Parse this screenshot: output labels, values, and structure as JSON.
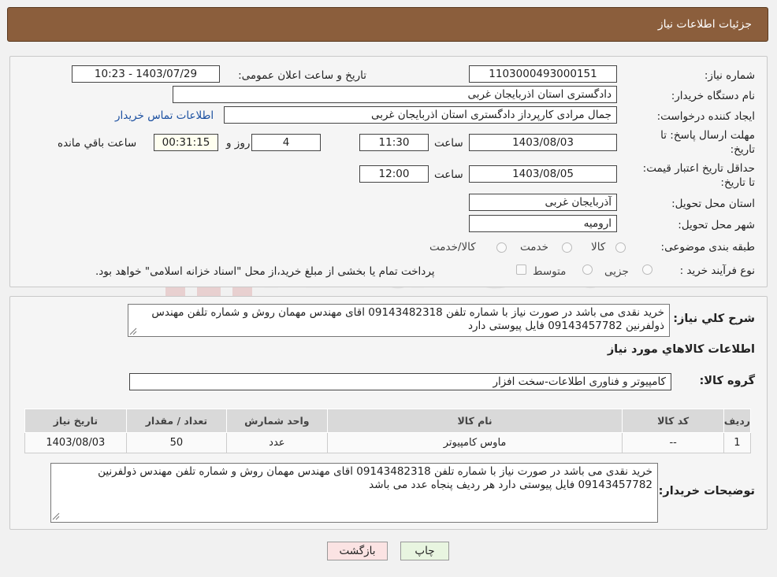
{
  "header": {
    "title": "جزئیات اطلاعات نیاز"
  },
  "form": {
    "need_number": {
      "label": "شماره نیاز:",
      "value": "1103000493000151"
    },
    "announce": {
      "label": "تاریخ و ساعت اعلان عمومی:",
      "value": "1403/07/29 - 10:23"
    },
    "buyer_org": {
      "label": "نام دستگاه خریدار:",
      "value": "دادگستری استان اذربایجان غربی"
    },
    "creator": {
      "label": "ایجاد کننده درخواست:",
      "value": "جمال مرادی کارپرداز دادگستری استان اذربایجان غربی",
      "link": "اطلاعات تماس خریدار"
    },
    "reply_deadline": {
      "label": "مهلت ارسال پاسخ: تا تاریخ:",
      "date": "1403/08/03",
      "time_label": "ساعت",
      "time": "11:30",
      "days": "4",
      "days_label": "روز و",
      "remaining": "00:31:15",
      "remaining_label": "ساعت باقي مانده"
    },
    "price_validity": {
      "label": "حداقل تاریخ اعتبار قیمت: تا تاریخ:",
      "date": "1403/08/05",
      "time_label": "ساعت",
      "time": "12:00"
    },
    "province": {
      "label": "استان محل تحویل:",
      "value": "آذربایجان غربی"
    },
    "city": {
      "label": "شهر محل تحویل:",
      "value": "ارومیه"
    },
    "category": {
      "label": "طبقه بندی موضوعی:",
      "options": [
        "کالا",
        "خدمت",
        "کالا/خدمت"
      ]
    },
    "purchase_type": {
      "label": "نوع فرآیند خرید :",
      "options": [
        "جزیی",
        "متوسط"
      ],
      "note": "پرداخت تمام یا بخشی از مبلغ خرید،از محل \"اسناد خزانه اسلامی\" خواهد بود."
    }
  },
  "watermark": {
    "text": "AriaTender.neT"
  },
  "description": {
    "label": "شرح کلي نياز:",
    "text": "خرید نقدی  می باشد در صورت نیاز با شماره تلفن 09143482318 اقای مهندس مهمان روش و شماره تلفن مهندس ذولفرنین 09143457782  فایل پیوستی دارد"
  },
  "goods_info": {
    "title": "اطلاعات کالاهاي مورد نياز"
  },
  "goods_group": {
    "label": "گروه کالا:",
    "value": "کامپیوتر و فناوری اطلاعات-سخت افزار"
  },
  "table": {
    "headers": [
      "ردیف",
      "کد کالا",
      "نام کالا",
      "واحد شمارش",
      "تعداد / مقدار",
      "تاریخ نیاز"
    ],
    "rows": [
      [
        "1",
        "--",
        "ماوس کامپیوتر",
        "عدد",
        "50",
        "1403/08/03"
      ]
    ]
  },
  "buyer_notes": {
    "label": "توضیحات خریدار:",
    "text": "خرید نقدی  می باشد در صورت نیاز با شماره تلفن 09143482318 اقای مهندس مهمان روش و شماره تلفن مهندس ذولفرنین 09143457782  فایل پیوستی دارد   هر ردیف پنجاه  عدد  می باشد"
  },
  "buttons": {
    "print": "چاپ",
    "back": "بازگشت"
  }
}
